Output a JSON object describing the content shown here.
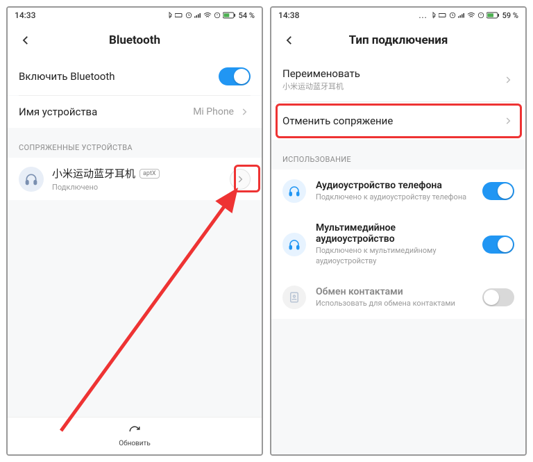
{
  "left": {
    "status": {
      "time": "14:33",
      "battery": "54 %"
    },
    "title": "Bluetooth",
    "rows": {
      "enable": "Включить Bluetooth",
      "device_name_label": "Имя устройства",
      "device_name_value": "Mi Phone"
    },
    "paired_header": "СОПРЯЖЕННЫЕ УСТРОЙСТВА",
    "device": {
      "name": "小米运动蓝牙耳机",
      "codec": "aptX",
      "status": "Подключено"
    },
    "footer": "Обновить"
  },
  "right": {
    "status": {
      "time": "14:38",
      "battery": "59 %"
    },
    "title": "Тип подключения",
    "rename": {
      "label": "Переименовать",
      "sub": "小米运动蓝牙耳机"
    },
    "unpair": "Отменить сопряжение",
    "usage_header": "ИСПОЛЬЗОВАНИЕ",
    "usage": [
      {
        "title": "Аудиоустройство телефона",
        "sub": "Подключено к аудиоустройству телефона",
        "on": true,
        "dim": false
      },
      {
        "title": "Мультимедийное аудиоустройство",
        "sub": "Подключено к мультимедийному аудиоустройству",
        "on": true,
        "dim": false
      },
      {
        "title": "Обмен контактами",
        "sub": "Использовать для обмена контактами",
        "on": false,
        "dim": true
      }
    ]
  }
}
